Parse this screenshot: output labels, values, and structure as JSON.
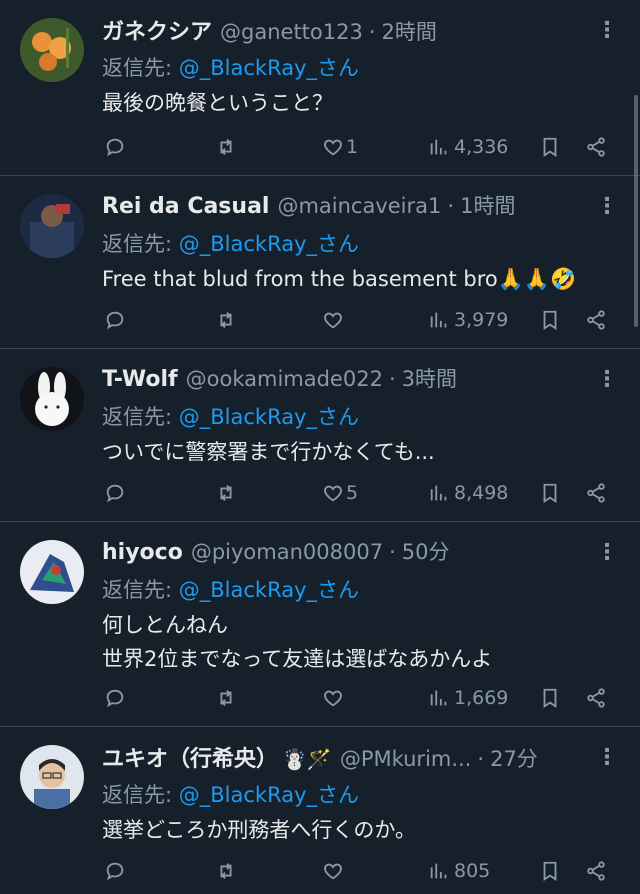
{
  "tweets": [
    {
      "name": "ガネクシア",
      "emoji": "",
      "handle": "@ganetto123",
      "time": "2時間",
      "reply_prefix": "返信先:",
      "reply_to": "@_BlackRay_さん",
      "text": [
        "最後の晩餐ということ？"
      ],
      "likes": "1",
      "views": "4,336"
    },
    {
      "name": "Rei da Casual",
      "emoji": "",
      "handle": "@maincaveira1",
      "time": "1時間",
      "reply_prefix": "返信先:",
      "reply_to": "@_BlackRay_さん",
      "text": [
        "Free that blud from the basement bro🙏🙏🤣"
      ],
      "likes": "",
      "views": "3,979"
    },
    {
      "name": "T-Wolf",
      "emoji": "",
      "handle": "@ookamimade022",
      "time": "3時間",
      "reply_prefix": "返信先:",
      "reply_to": "@_BlackRay_さん",
      "text": [
        "ついでに警察署まで行かなくても..."
      ],
      "likes": "5",
      "views": "8,498"
    },
    {
      "name": "hiyoco",
      "emoji": "",
      "handle": "@piyoman008007",
      "time": "50分",
      "reply_prefix": "返信先:",
      "reply_to": "@_BlackRay_さん",
      "text": [
        "何しとんねん",
        "世界2位までなって友達は選ばなあかんよ"
      ],
      "likes": "",
      "views": "1,669"
    },
    {
      "name": "ユキオ（行希央）",
      "emoji": "☃️🪄",
      "handle": "@PMkurim...",
      "time": "27分",
      "reply_prefix": "返信先:",
      "reply_to": "@_BlackRay_さん",
      "text": [
        "選挙どころか刑務者へ行くのか。"
      ],
      "likes": "",
      "views": "805"
    }
  ],
  "icons": {
    "reply": "reply-icon",
    "retweet": "retweet-icon",
    "like": "heart-icon",
    "views": "views-icon",
    "bookmark": "bookmark-icon",
    "share": "share-icon",
    "more": "more-icon"
  },
  "colors": {
    "background": "#15202b",
    "text": "#e7e9ea",
    "muted": "#8b98a5",
    "link": "#1d9bf0",
    "divider": "#38444d"
  }
}
